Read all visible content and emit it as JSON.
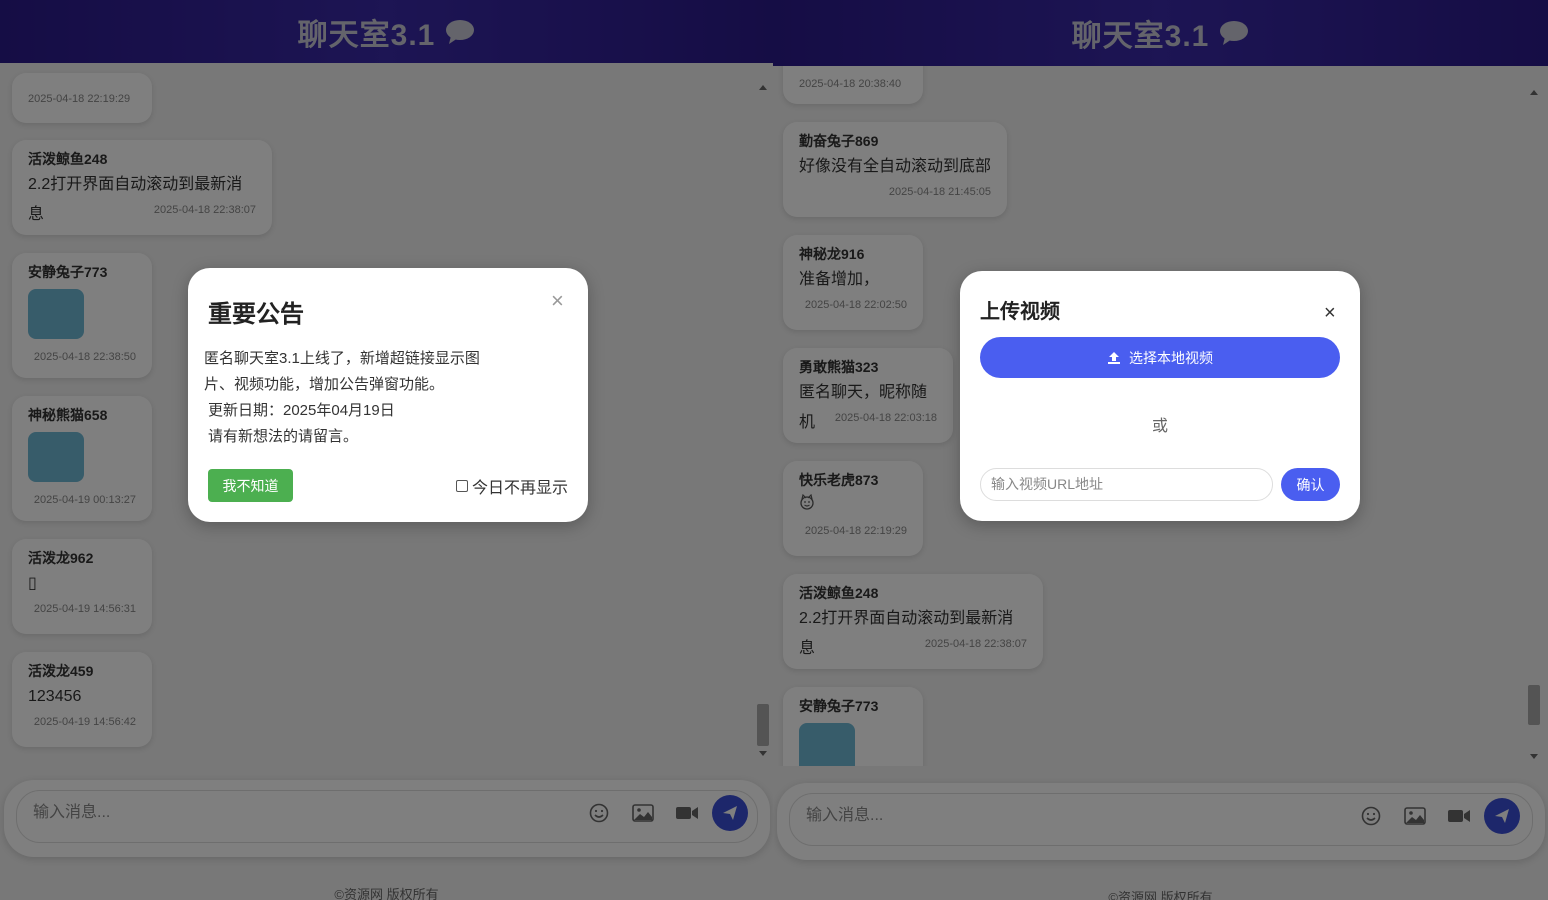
{
  "left_panel": {
    "header": {
      "title": "聊天室3.1"
    },
    "messages": [
      {
        "time": "2025-04-18 22:19:29"
      },
      {
        "user": "活泼鲸鱼248",
        "text": "2.2打开界面自动滚动到最新消息",
        "time": "2025-04-18 22:38:07"
      },
      {
        "user": "安静兔子773",
        "time": "2025-04-18 22:38:50"
      },
      {
        "user": "神秘熊猫658",
        "time": "2025-04-19 00:13:27"
      },
      {
        "user": "活泼龙962",
        "text": "▯",
        "time": "2025-04-19 14:56:31"
      },
      {
        "user": "活泼龙459",
        "text": "123456",
        "time": "2025-04-19 14:56:42"
      }
    ],
    "input": {
      "placeholder": "输入消息..."
    },
    "footer": "©资源网 版权所有",
    "notice_modal": {
      "title": "重要公告",
      "close": "×",
      "lines": [
        "匿名聊天室3.1上线了，新增超链接显示图",
        "片、视频功能，增加公告弹窗功能。",
        "更新日期：2025年04月19日",
        "请有新想法的请留言。"
      ],
      "ok_label": "我不知道",
      "dont_show_label": "今日不再显示"
    }
  },
  "right_panel": {
    "header": {
      "title": "聊天室3.1"
    },
    "messages": [
      {
        "time": "2025-04-18 20:38:40"
      },
      {
        "user": "勤奋兔子869",
        "text": "好像没有全自动滚动到底部",
        "time": "2025-04-18 21:45:05"
      },
      {
        "user": "神秘龙916",
        "text": "准备增加，",
        "time": "2025-04-18 22:02:50"
      },
      {
        "user": "勇敢熊猫323",
        "text": "匿名聊天，昵称随机",
        "time": "2025-04-18 22:03:18"
      },
      {
        "user": "快乐老虎873",
        "time": "2025-04-18 22:19:29"
      },
      {
        "user": "活泼鲸鱼248",
        "text": "2.2打开界面自动滚动到最新消息",
        "time": "2025-04-18 22:38:07"
      },
      {
        "user": "安静兔子773"
      }
    ],
    "input": {
      "placeholder": "输入消息..."
    },
    "footer": "©资源网 版权所有",
    "upload_modal": {
      "title": "上传视频",
      "close": "×",
      "select_label": "选择本地视频",
      "or_label": "或",
      "url_placeholder": "输入视频URL地址",
      "confirm_label": "确认"
    }
  },
  "colors": {
    "header_bg": "#2b1a8a",
    "send_button": "#3b4fd6",
    "ok_button": "#4caf50",
    "upload_button": "#4a5ef0"
  }
}
